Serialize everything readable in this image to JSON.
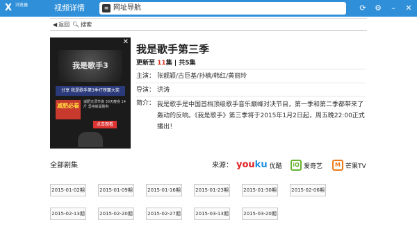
{
  "topbar": {
    "logo_glyph": "X",
    "logo_text": "浏览器",
    "tab_label": "视频详情",
    "url_icon": "≡",
    "url_text": "网址导航",
    "icons": [
      "refresh-icon",
      "settings-icon",
      "minimize-icon",
      "close-icon"
    ],
    "icon_glyphs": [
      "⟳",
      "⚙",
      "–",
      "✕"
    ]
  },
  "nav": {
    "back_label": "返回",
    "search_label": "搜索"
  },
  "poster": {
    "close_glyph": "✕",
    "title": "我是歌手3",
    "banner": "分享 我是歌手第3季打榜赢大奖",
    "red_label": "减肥必看",
    "desc": "减肥无须节食 30天瘦身 14斤 坚持就是胜利",
    "button": "点击观看"
  },
  "show": {
    "title": "我是歌手第三季",
    "update_prefix": "更新至",
    "update_num": "11",
    "update_suffix": "集 | 共5集",
    "cast_label": "主演：",
    "cast": "张靓颖/古巨基/孙楠/韩红/黄丽玲",
    "director_label": "导演：",
    "director": "洪涛",
    "intro_label": "简介：",
    "intro": "我是歌手是中国首档顶级歌手音乐巅峰对决节目，第一季和第二季都带来了轰动的反响。《我是歌手》第三季将于2015年1月2日起，周五晚22:00正式播出！"
  },
  "episodes_header": {
    "all_label": "全部剧集",
    "source_label": "来源：",
    "sources": [
      {
        "name": "优酷",
        "logo": "youku"
      },
      {
        "name": "爱奇艺",
        "logo": "iqiyi"
      },
      {
        "name": "芒果TV",
        "logo": "mango"
      }
    ]
  },
  "episodes": [
    "2015-01-02期",
    "2015-01-09期",
    "2015-01-16期",
    "2015-01-23期",
    "2015-01-30期",
    "2015-02-06期",
    "2015-02-13期",
    "2015-02-20期",
    "2015-02-27期",
    "2015-03-13期",
    "2015-03-20期"
  ]
}
